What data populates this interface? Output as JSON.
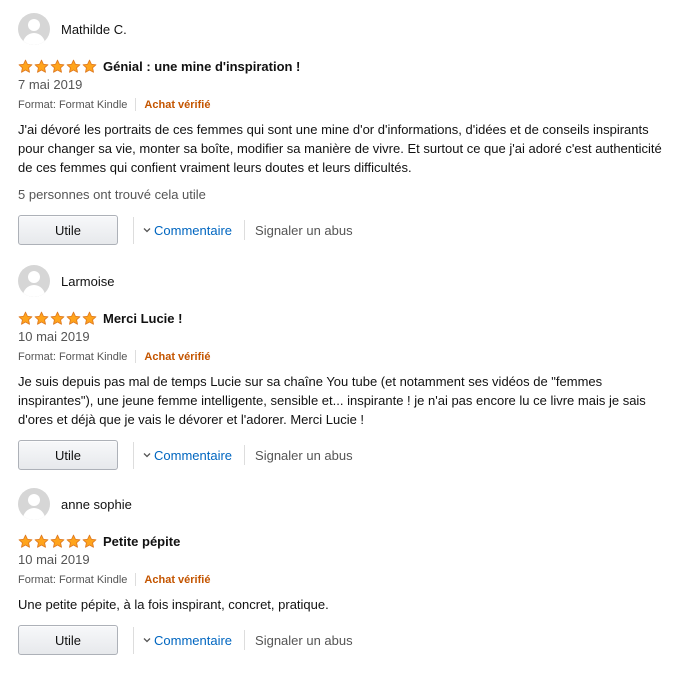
{
  "colors": {
    "star": "#ffa41c",
    "verified": "#c45500",
    "link": "#0066c0"
  },
  "icons": {
    "avatar": "default-user-avatar-icon",
    "star": "filled-star-icon",
    "chevron": "chevron-down-icon"
  },
  "reviews": [
    {
      "author": "Mathilde C.",
      "rating": 5,
      "title": "Génial : une mine d'inspiration !",
      "date": "7 mai 2019",
      "format": "Format: Format Kindle",
      "verified": "Achat vérifié",
      "text": "J'ai dévoré les portraits de ces femmes qui sont une mine d'or d'informations, d'idées et de conseils inspirants pour changer sa vie, monter sa boîte, modifier sa manière de vivre. Et surtout ce que j'ai adoré c'est authenticité de ces femmes qui confient vraiment leurs doutes et leurs difficultés.",
      "helpful": "5 personnes ont trouvé cela utile",
      "helpful_button": "Utile",
      "comment_label": "Commentaire",
      "report_label": "Signaler un abus"
    },
    {
      "author": "Larmoise",
      "rating": 5,
      "title": "Merci Lucie !",
      "date": "10 mai 2019",
      "format": "Format: Format Kindle",
      "verified": "Achat vérifié",
      "text": "Je suis depuis pas mal de temps Lucie sur sa chaîne You tube (et notamment ses vidéos de \"femmes inspirantes\"), une jeune femme intelligente, sensible et... inspirante ! je n'ai pas encore lu ce livre mais je sais d'ores et déjà que je vais le dévorer et l'adorer. Merci Lucie !",
      "helpful_button": "Utile",
      "comment_label": "Commentaire",
      "report_label": "Signaler un abus"
    },
    {
      "author": "anne sophie",
      "rating": 5,
      "title": "Petite pépite",
      "date": "10 mai 2019",
      "format": "Format: Format Kindle",
      "verified": "Achat vérifié",
      "text": "Une petite pépite, à la fois inspirant, concret, pratique.",
      "helpful_button": "Utile",
      "comment_label": "Commentaire",
      "report_label": "Signaler un abus"
    }
  ]
}
